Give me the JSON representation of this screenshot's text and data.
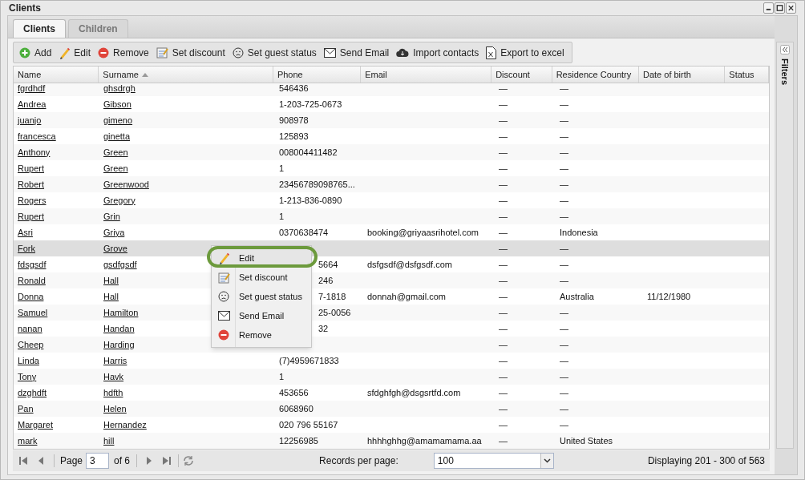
{
  "window": {
    "title": "Clients"
  },
  "tabs": [
    {
      "label": "Clients",
      "selected": true
    },
    {
      "label": "Children",
      "selected": false
    }
  ],
  "toolbar": [
    {
      "kind": "add",
      "label": "Add"
    },
    {
      "kind": "edit",
      "label": "Edit"
    },
    {
      "kind": "remove",
      "label": "Remove"
    },
    {
      "kind": "discount",
      "label": "Set discount"
    },
    {
      "kind": "guest",
      "label": "Set guest status"
    },
    {
      "kind": "email",
      "label": "Send Email"
    },
    {
      "kind": "import",
      "label": "Import contacts"
    },
    {
      "kind": "excel",
      "label": "Export to excel"
    }
  ],
  "table": {
    "columns": [
      {
        "label": "Name"
      },
      {
        "label": "Surname",
        "sorted": true
      },
      {
        "label": "Phone"
      },
      {
        "label": "Email"
      },
      {
        "label": "Discount"
      },
      {
        "label": "Residence Country"
      },
      {
        "label": "Date of birth"
      },
      {
        "label": "Status"
      }
    ],
    "rows": [
      {
        "selected": false,
        "cells": [
          "fgrdhdf",
          "ghsdrgh",
          "546436",
          "",
          "—",
          "—",
          ""
        ]
      },
      {
        "selected": false,
        "cells": [
          "Andrea",
          "Gibson",
          "1-203-725-0673",
          "",
          "—",
          "—",
          ""
        ]
      },
      {
        "selected": false,
        "cells": [
          "juanjo",
          "gimeno",
          "908978",
          "",
          "—",
          "—",
          ""
        ]
      },
      {
        "selected": false,
        "cells": [
          "francesca",
          "ginetta",
          "125893",
          "",
          "—",
          "—",
          ""
        ]
      },
      {
        "selected": false,
        "cells": [
          "Anthony",
          "Green",
          "008004411482",
          "",
          "—",
          "—",
          ""
        ]
      },
      {
        "selected": false,
        "cells": [
          "Rupert",
          "Green",
          "1",
          "",
          "—",
          "—",
          ""
        ]
      },
      {
        "selected": false,
        "cells": [
          "Robert",
          "Greenwood",
          "23456789098765...",
          "",
          "—",
          "—",
          ""
        ]
      },
      {
        "selected": false,
        "cells": [
          "Rogers",
          "Gregory",
          "1-213-836-0890",
          "",
          "—",
          "—",
          ""
        ]
      },
      {
        "selected": false,
        "cells": [
          "Rupert",
          "Grin",
          "1",
          "",
          "—",
          "—",
          ""
        ]
      },
      {
        "selected": false,
        "cells": [
          "Asri",
          "Griya",
          "0370638474",
          "booking@griyaasrihotel.com",
          "—",
          "Indonesia",
          ""
        ]
      },
      {
        "selected": true,
        "cells": [
          "Fork",
          "Grove",
          "",
          "",
          "—",
          "—",
          ""
        ]
      },
      {
        "selected": false,
        "phone_partial": true,
        "cells": [
          "fdsgsdf",
          "gsdfgsdf",
          "5664",
          "dsfgsdf@dsfgsdf.com",
          "—",
          "—",
          ""
        ]
      },
      {
        "selected": false,
        "phone_partial": true,
        "cells": [
          "Ronald",
          "Hall",
          "246",
          "",
          "—",
          "—",
          ""
        ]
      },
      {
        "selected": false,
        "phone_partial": true,
        "cells": [
          "Donna",
          "Hall",
          "7-1818",
          "donnah@gmail.com",
          "—",
          "Australia",
          "11/12/1980"
        ]
      },
      {
        "selected": false,
        "phone_partial": true,
        "cells": [
          "Samuel",
          "Hamilton",
          "25-0056",
          "",
          "—",
          "—",
          ""
        ]
      },
      {
        "selected": false,
        "phone_partial": true,
        "cells": [
          "nanan",
          "Handan",
          "32",
          "",
          "—",
          "—",
          ""
        ]
      },
      {
        "selected": false,
        "cells": [
          "Cheep",
          "Harding",
          "",
          "",
          "—",
          "—",
          ""
        ]
      },
      {
        "selected": false,
        "cells": [
          "Linda",
          "Harris",
          "(7)4959671833",
          "",
          "—",
          "—",
          ""
        ]
      },
      {
        "selected": false,
        "cells": [
          "Tony",
          "Havk",
          "1",
          "",
          "—",
          "—",
          ""
        ]
      },
      {
        "selected": false,
        "cells": [
          "dzghdft",
          "hdfth",
          "453656",
          "sfdghfgh@dsgsrtfd.com",
          "—",
          "—",
          ""
        ]
      },
      {
        "selected": false,
        "cells": [
          "Pan",
          "Helen",
          "6068960",
          "",
          "—",
          "—",
          ""
        ]
      },
      {
        "selected": false,
        "cells": [
          "Margaret",
          "Hernandez",
          "020 796 55167",
          "",
          "—",
          "—",
          ""
        ]
      },
      {
        "selected": false,
        "cells": [
          "mark",
          "hill",
          "12256985",
          "hhhhghhg@amamamama.aa",
          "—",
          "United States",
          ""
        ]
      }
    ]
  },
  "context_menu": [
    {
      "kind": "edit",
      "label": "Edit",
      "highlighted": true
    },
    {
      "kind": "discount",
      "label": "Set discount",
      "highlighted": false
    },
    {
      "kind": "guest",
      "label": "Set guest status",
      "highlighted": false
    },
    {
      "kind": "email",
      "label": "Send Email",
      "highlighted": false
    },
    {
      "kind": "remove",
      "label": "Remove",
      "highlighted": false
    }
  ],
  "filters_panel": {
    "title": "Filters"
  },
  "pager": {
    "page_label": "Page",
    "page": "3",
    "of": "of 6",
    "records_label": "Records per page:",
    "records": "100",
    "display": "Displaying 201 - 300 of 563"
  }
}
